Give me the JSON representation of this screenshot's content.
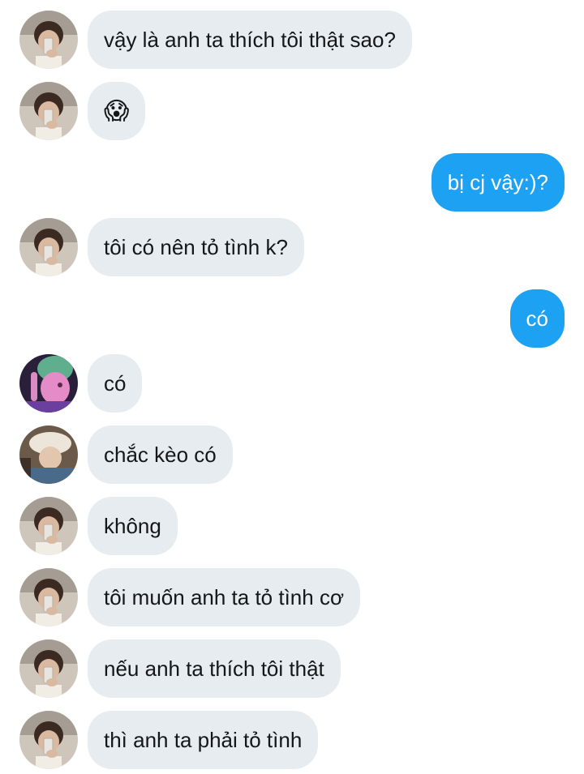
{
  "messages": [
    {
      "sender": "other",
      "avatar": "mirror-selfie-avatar",
      "text": "vậy là anh ta thích tôi thật sao?"
    },
    {
      "sender": "other",
      "avatar": "mirror-selfie-avatar",
      "text": "😱"
    },
    {
      "sender": "me",
      "text": "bị cj vậy:)?"
    },
    {
      "sender": "other",
      "avatar": "mirror-selfie-avatar",
      "text": "tôi có nên tỏ tình k?"
    },
    {
      "sender": "me",
      "text": "có"
    },
    {
      "sender": "other",
      "avatar": "green-hair-avatar",
      "text": "có"
    },
    {
      "sender": "other",
      "avatar": "bucket-hat-avatar",
      "text": "chắc kèo có"
    },
    {
      "sender": "other",
      "avatar": "mirror-selfie-avatar",
      "text": "không"
    },
    {
      "sender": "other",
      "avatar": "mirror-selfie-avatar",
      "text": "tôi muốn anh ta tỏ tình cơ"
    },
    {
      "sender": "other",
      "avatar": "mirror-selfie-avatar",
      "text": "nếu anh ta thích tôi thật"
    },
    {
      "sender": "other",
      "avatar": "mirror-selfie-avatar",
      "text": "thì anh ta phải tỏ tình"
    }
  ],
  "colors": {
    "incoming_bubble": "#e6ecf0",
    "outgoing_bubble": "#1da1f2",
    "incoming_text": "#14171a",
    "outgoing_text": "#ffffff"
  }
}
